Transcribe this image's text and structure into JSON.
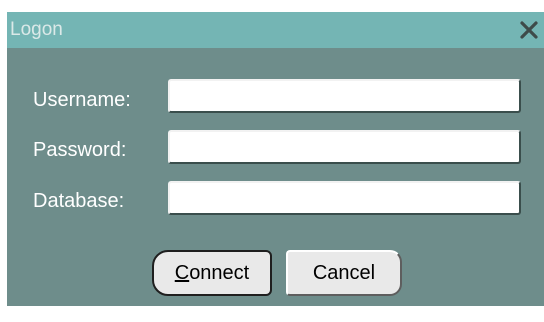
{
  "dialog": {
    "title": "Logon",
    "close_icon": "close-icon"
  },
  "fields": {
    "username": {
      "label": "Username:",
      "value": ""
    },
    "password": {
      "label": "Password:",
      "value": ""
    },
    "database": {
      "label": "Database:",
      "value": ""
    }
  },
  "buttons": {
    "connect": {
      "mnemonic": "C",
      "rest": "onnect"
    },
    "cancel": {
      "label": "Cancel"
    }
  },
  "colors": {
    "titlebar": "#74b5b4",
    "body": "#6e8d8b",
    "button_face": "#e9e9e9"
  }
}
